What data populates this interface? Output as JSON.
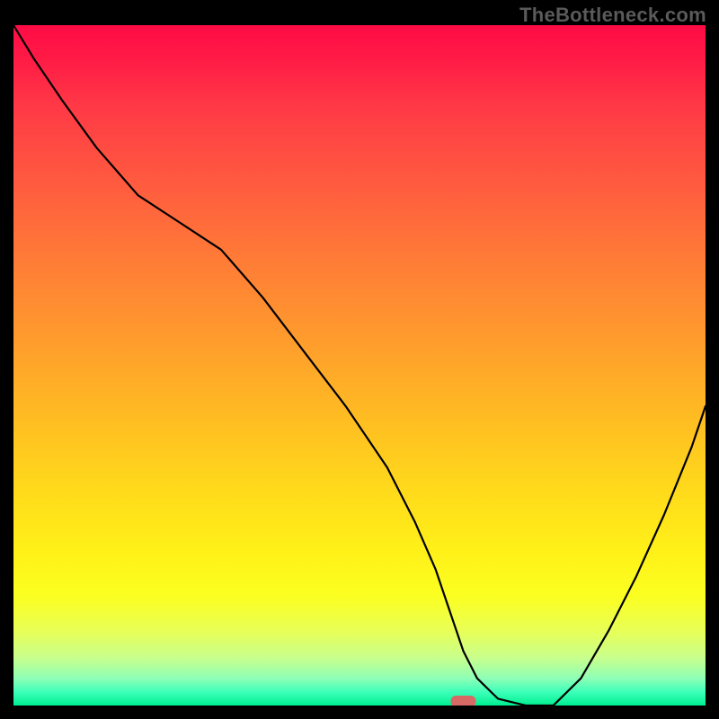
{
  "watermark": "TheBottleneck.com",
  "colors": {
    "frame": "#000000",
    "line": "#000000",
    "marker": "#d76a64",
    "gradient_top": "#ff0b45",
    "gradient_bottom": "#00ef91"
  },
  "chart_data": {
    "type": "line",
    "title": "",
    "xlabel": "",
    "ylabel": "",
    "xlim": [
      0,
      100
    ],
    "ylim": [
      0,
      100
    ],
    "x": [
      0,
      3,
      7,
      12,
      18,
      24,
      30,
      36,
      42,
      48,
      54,
      58,
      61,
      63,
      65,
      67,
      70,
      74,
      78,
      82,
      86,
      90,
      94,
      98,
      100
    ],
    "values": [
      100,
      95,
      89,
      82,
      75,
      71,
      67,
      60,
      52,
      44,
      35,
      27,
      20,
      14,
      8,
      4,
      1,
      0,
      0,
      4,
      11,
      19,
      28,
      38,
      44
    ],
    "series": [
      {
        "name": "bottleneck-curve",
        "x": [
          0,
          3,
          7,
          12,
          18,
          24,
          30,
          36,
          42,
          48,
          54,
          58,
          61,
          63,
          65,
          67,
          70,
          74,
          78,
          82,
          86,
          90,
          94,
          98,
          100
        ],
        "y": [
          100,
          95,
          89,
          82,
          75,
          71,
          67,
          60,
          52,
          44,
          35,
          27,
          20,
          14,
          8,
          4,
          1,
          0,
          0,
          4,
          11,
          19,
          28,
          38,
          44
        ]
      }
    ],
    "marker": {
      "x": 65,
      "y": 0,
      "shape": "rounded-rect"
    }
  }
}
